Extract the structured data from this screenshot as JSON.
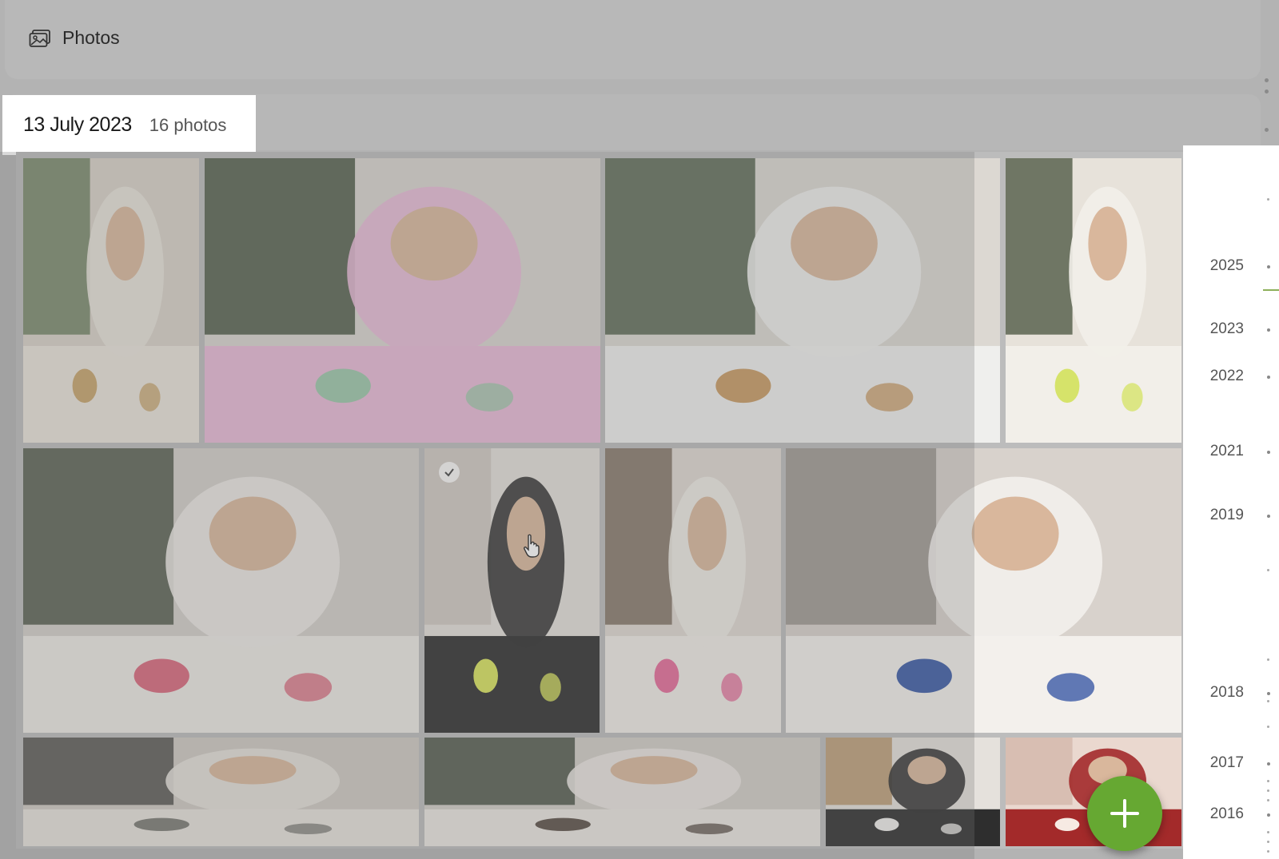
{
  "app": {
    "title": "Photos",
    "icon": "photo-gallery-icon"
  },
  "group": {
    "date": "13 July 2023",
    "count": "16 photos"
  },
  "photos": [
    {
      "label": "girl holding painted egg",
      "tones": [
        "#5d7350",
        "#d8d2c8",
        "#e9e3da",
        "#c7a46b"
      ]
    },
    {
      "label": "girl with easter bowl and letter board",
      "tones": [
        "#2d3d2a",
        "#d9d5cf",
        "#e8b9d6",
        "#9cc7a9"
      ]
    },
    {
      "label": "two kids painting at table",
      "tones": [
        "#3b4d34",
        "#dcd8d2",
        "#efefed",
        "#c89a63"
      ]
    },
    {
      "label": "girl painting egg closeup",
      "tones": [
        "#47523c",
        "#e7e2da",
        "#f2efe9",
        "#d6e36a"
      ]
    },
    {
      "label": "kids painting eggs with brushes",
      "tones": [
        "#35402f",
        "#d3cfca",
        "#ece9e4",
        "#d9677c"
      ]
    },
    {
      "label": "hands painting striped cloth egg",
      "tones": [
        "#c9c2b9",
        "#e4e0da",
        "#2e2e2e",
        "#d9e45c"
      ]
    },
    {
      "label": "girl holding pink egg",
      "tones": [
        "#6b5a4a",
        "#dfd9d1",
        "#f0ece6",
        "#e56b99"
      ]
    },
    {
      "label": "boy with paintbrush",
      "tones": [
        "#8d8781",
        "#d8d2cc",
        "#f3f0ec",
        "#3b5aa6"
      ]
    },
    {
      "label": "kitchen with plant",
      "tones": [
        "#3a3a36",
        "#cfcac3",
        "#e6e2dc",
        "#7a7a74"
      ]
    },
    {
      "label": "child by plant",
      "tones": [
        "#2f3a2c",
        "#d2cdc7",
        "#ebe7e1",
        "#5a4f47"
      ]
    },
    {
      "label": "striped cloth and brush",
      "tones": [
        "#b08a5a",
        "#e5e1dc",
        "#2e2e2e",
        "#efeeea"
      ]
    },
    {
      "label": "girl with red sleeves",
      "tones": [
        "#d2b6a8",
        "#ead8cf",
        "#a32a2a",
        "#f6eae3"
      ]
    }
  ],
  "timeline": {
    "years": [
      "2025",
      "2023",
      "2022",
      "2021",
      "2019",
      "2018",
      "2017",
      "2016"
    ]
  },
  "fab": {
    "icon": "plus-icon",
    "color": "#66a832"
  }
}
